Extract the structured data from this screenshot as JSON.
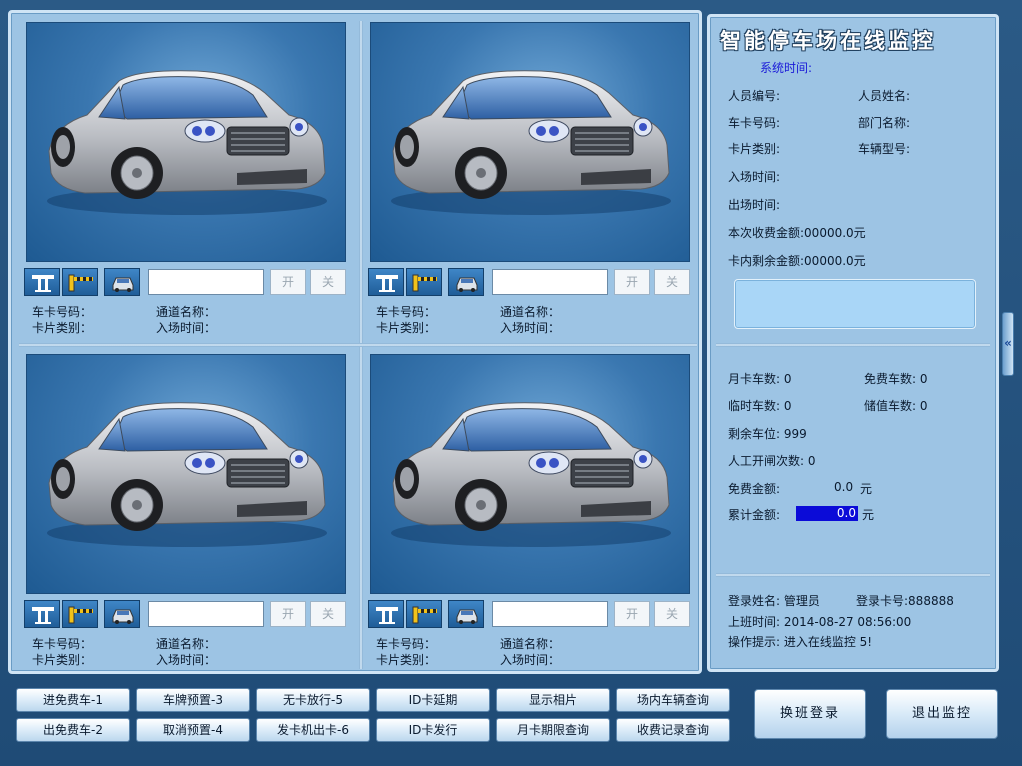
{
  "cameras": [
    {
      "field_card": "车卡号码：",
      "field_channel": "通道名称：",
      "field_type": "卡片类别：",
      "field_entry": "入场时间：",
      "open_label": "开",
      "close_label": "关"
    },
    {
      "field_card": "车卡号码：",
      "field_channel": "通道名称：",
      "field_type": "卡片类别：",
      "field_entry": "入场时间：",
      "open_label": "开",
      "close_label": "关"
    },
    {
      "field_card": "车卡号码：",
      "field_channel": "通道名称：",
      "field_type": "卡片类别：",
      "field_entry": "入场时间：",
      "open_label": "开",
      "close_label": "关"
    },
    {
      "field_card": "车卡号码：",
      "field_channel": "通道名称：",
      "field_type": "卡片类别：",
      "field_entry": "入场时间：",
      "open_label": "开",
      "close_label": "关"
    }
  ],
  "monitor": {
    "title": "智能停车场在线监控",
    "system_time": "系统时间:",
    "person_id": "人员编号:",
    "person_name": "人员姓名:",
    "card_no": "车卡号码:",
    "dept": "部门名称:",
    "card_type": "卡片类别:",
    "vehicle_model": "车辆型号:",
    "entry_time": "入场时间:",
    "exit_time": "出场时间:",
    "charge_amount": "本次收费金额:00000.0元",
    "card_balance": "卡内剩余金额:00000.0元"
  },
  "stats": {
    "monthly": "月卡车数: 0",
    "free": "免费车数: 0",
    "temp": "临时车数: 0",
    "stored": "储值车数: 0",
    "spaces": "剩余车位: 999",
    "manual": "人工开闸次数: 0",
    "free_amount_label": "免费金额:",
    "free_amount_value": "0.0",
    "yuan": "元",
    "total_label": "累计金额:",
    "total_value": "0.0"
  },
  "login": {
    "name": "登录姓名: 管理员",
    "card": "登录卡号:888888",
    "shift_time": "上班时间: 2014-08-27 08:56:00",
    "hint": "操作提示: 进入在线监控 5!"
  },
  "buttons": {
    "b1": "进免费车-1",
    "b2": "车牌预置-3",
    "b3": "无卡放行-5",
    "b4": "ID卡延期",
    "b5": "显示相片",
    "b6": "场内车辆查询",
    "b7": "出免费车-2",
    "b8": "取消预置-4",
    "b9": "发卡机出卡-6",
    "b10": "ID卡发行",
    "b11": "月卡期限查询",
    "b12": "收费记录查询",
    "shift": "换班登录",
    "exit": "退出监控"
  },
  "side_handle": "«",
  "colors": {
    "panel": "#9dc4e4",
    "background": "#1f4b76",
    "highlight": "#0b0bd8",
    "time_text": "#1a1ad8"
  }
}
